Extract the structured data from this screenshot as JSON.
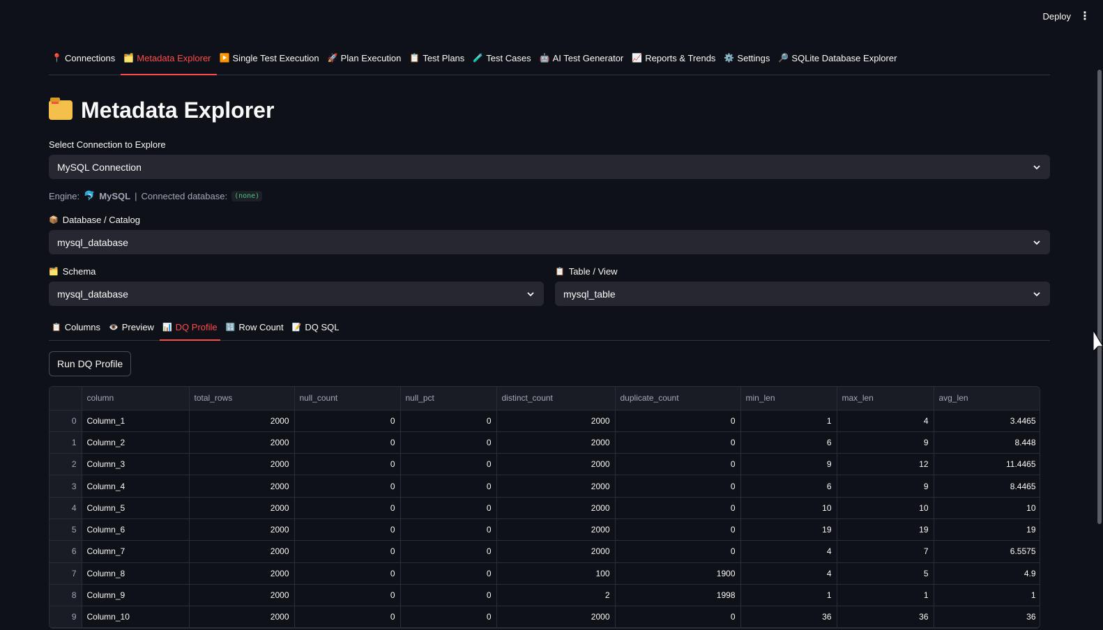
{
  "header": {
    "deploy_label": "Deploy",
    "menu_glyph": "⋮"
  },
  "nav_tabs": [
    {
      "icon": "📍",
      "label": "Connections",
      "active": false
    },
    {
      "icon": "🗂️",
      "label": "Metadata Explorer",
      "active": true
    },
    {
      "icon": "▶️",
      "label": "Single Test Execution",
      "active": false
    },
    {
      "icon": "🚀",
      "label": "Plan Execution",
      "active": false
    },
    {
      "icon": "📋",
      "label": "Test Plans",
      "active": false
    },
    {
      "icon": "🧪",
      "label": "Test Cases",
      "active": false
    },
    {
      "icon": "🤖",
      "label": "AI Test Generator",
      "active": false
    },
    {
      "icon": "📈",
      "label": "Reports & Trends",
      "active": false
    },
    {
      "icon": "⚙️",
      "label": "Settings",
      "active": false
    },
    {
      "icon": "🔎",
      "label": "SQLite Database Explorer",
      "active": false
    }
  ],
  "page": {
    "title": "Metadata Explorer"
  },
  "connection": {
    "label": "Select Connection to Explore",
    "value": "MySQL Connection"
  },
  "engine": {
    "prefix": "Engine:",
    "engine_name": "MySQL",
    "separator": "|",
    "db_label": "Connected database:",
    "db_value": "(none)"
  },
  "database": {
    "icon": "📦",
    "label": "Database / Catalog",
    "value": "mysql_database"
  },
  "schema": {
    "icon": "🗂️",
    "label": "Schema",
    "value": "mysql_database"
  },
  "table_view": {
    "icon": "📋",
    "label": "Table / View",
    "value": "mysql_table"
  },
  "sub_tabs": [
    {
      "icon": "📋",
      "label": "Columns",
      "active": false
    },
    {
      "icon": "👁️",
      "label": "Preview",
      "active": false
    },
    {
      "icon": "📊",
      "label": "DQ Profile",
      "active": true
    },
    {
      "icon": "🔢",
      "label": "Row Count",
      "active": false
    },
    {
      "icon": "📝",
      "label": "DQ SQL",
      "active": false
    }
  ],
  "run_button": "Run DQ Profile",
  "table": {
    "columns": [
      "",
      "column",
      "total_rows",
      "null_count",
      "null_pct",
      "distinct_count",
      "duplicate_count",
      "min_len",
      "max_len",
      "avg_len"
    ],
    "rows": [
      [
        "0",
        "Column_1",
        "2000",
        "0",
        "0",
        "2000",
        "0",
        "1",
        "4",
        "3.4465"
      ],
      [
        "1",
        "Column_2",
        "2000",
        "0",
        "0",
        "2000",
        "0",
        "6",
        "9",
        "8.448"
      ],
      [
        "2",
        "Column_3",
        "2000",
        "0",
        "0",
        "2000",
        "0",
        "9",
        "12",
        "11.4465"
      ],
      [
        "3",
        "Column_4",
        "2000",
        "0",
        "0",
        "2000",
        "0",
        "6",
        "9",
        "8.4465"
      ],
      [
        "4",
        "Column_5",
        "2000",
        "0",
        "0",
        "2000",
        "0",
        "10",
        "10",
        "10"
      ],
      [
        "5",
        "Column_6",
        "2000",
        "0",
        "0",
        "2000",
        "0",
        "19",
        "19",
        "19"
      ],
      [
        "6",
        "Column_7",
        "2000",
        "0",
        "0",
        "2000",
        "0",
        "4",
        "7",
        "6.5575"
      ],
      [
        "7",
        "Column_8",
        "2000",
        "0",
        "0",
        "100",
        "1900",
        "4",
        "5",
        "4.9"
      ],
      [
        "8",
        "Column_9",
        "2000",
        "0",
        "0",
        "2",
        "1998",
        "1",
        "1",
        "1"
      ],
      [
        "9",
        "Column_10",
        "2000",
        "0",
        "0",
        "2000",
        "0",
        "36",
        "36",
        "36"
      ]
    ]
  },
  "colors": {
    "accent": "#ff4b4b",
    "background": "#0e1117",
    "input_bg": "#262730"
  }
}
